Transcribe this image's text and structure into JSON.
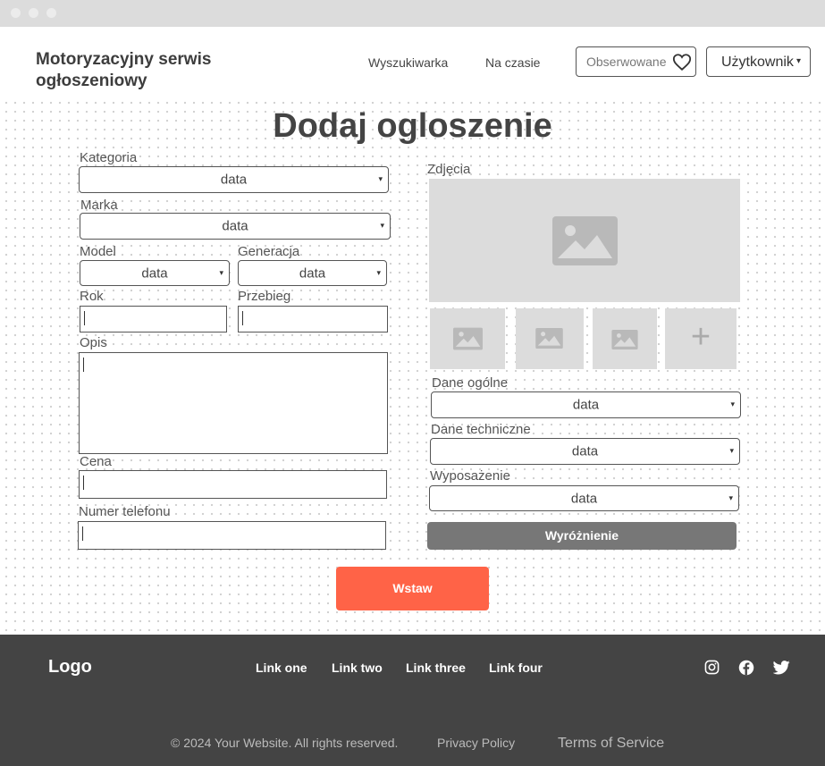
{
  "header": {
    "brand": "Motoryzacyjny serwis ogłoszeniowy",
    "nav_search": "Wyszukiwarka",
    "nav_trending": "Na czasie",
    "watched_label": "Obserwowane",
    "user_label": "Użytkownik"
  },
  "page": {
    "title": "Dodaj ogloszenie"
  },
  "form": {
    "category": {
      "label": "Kategoria",
      "value": "data"
    },
    "brand": {
      "label": "Marka",
      "value": "data"
    },
    "model": {
      "label": "Model",
      "value": "data"
    },
    "generation": {
      "label": "Generacja",
      "value": "data"
    },
    "year": {
      "label": "Rok",
      "value": ""
    },
    "mileage": {
      "label": "Przebieg",
      "value": ""
    },
    "description": {
      "label": "Opis",
      "value": ""
    },
    "price": {
      "label": "Cena",
      "value": ""
    },
    "phone": {
      "label": "Numer telefonu",
      "value": ""
    },
    "photos": {
      "label": "Zdjęcia"
    },
    "general": {
      "label": "Dane ogólne",
      "value": "data"
    },
    "technical": {
      "label": "Dane techniczne",
      "value": "data"
    },
    "equipment": {
      "label": "Wyposażenie",
      "value": "data"
    },
    "highlight_button": "Wyróżnienie",
    "submit_button": "Wstaw"
  },
  "footer": {
    "logo": "Logo",
    "links": [
      "Link one",
      "Link two",
      "Link three",
      "Link four"
    ],
    "copyright": "© 2024 Your Website. All rights reserved.",
    "privacy": "Privacy Policy",
    "terms": "Terms of Service"
  },
  "icons": {
    "arrow": "▾",
    "add": "+"
  }
}
